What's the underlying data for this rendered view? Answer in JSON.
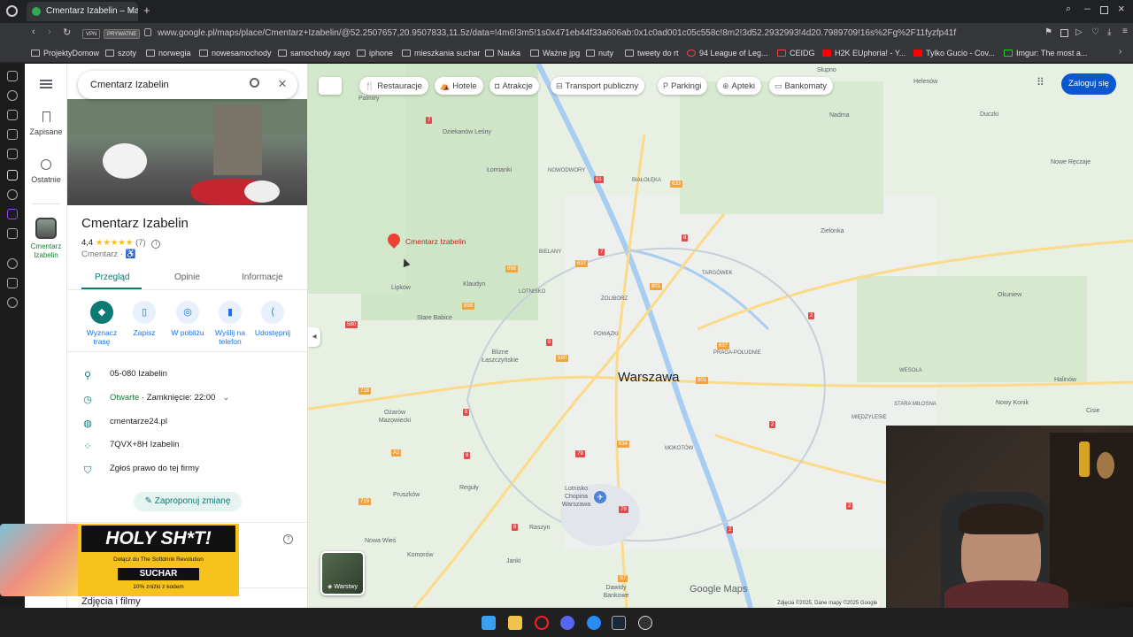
{
  "browser": {
    "tab_title": "Cmentarz Izabelin – Mapy",
    "url": "www.google.pl/maps/place/Cmentarz+Izabelin/@52.2507657,20.9507833,11.5z/data=!4m6!3m5!1s0x471eb44f33a606ab:0x1c0ad001c05c558c!8m2!3d52.2932993!4d20.7989709!16s%2Fg%2F11fyzfp41f",
    "vpn_label": "VPN",
    "private_label": "PRYWATNE",
    "bookmarks": [
      "ProjektyDomow",
      "szoty",
      "norwegia",
      "nowesamochody",
      "samochody xayo",
      "iphone",
      "mieszkania suchar",
      "Nauka",
      "Ważne jpg",
      "nuty",
      "tweety do rt",
      "94 League of Leg...",
      "CEIDG",
      "H2K EUphoria! - Y...",
      "Tylko Gucio - Cov...",
      "Imgur: The most a..."
    ]
  },
  "rail": {
    "saved_label": "Zapisane",
    "recent_label": "Ostatnie",
    "place_label": "Cmentarz Izabelin"
  },
  "panel": {
    "search_value": "Cmentarz Izabelin",
    "place_name": "Cmentarz Izabelin",
    "rating": "4,4",
    "stars": "★★★★★",
    "review_count": "(7)",
    "category": "Cmentarz",
    "tabs": [
      "Przegląd",
      "Opinie",
      "Informacje"
    ],
    "actions": [
      "Wyznacz trasę",
      "Zapisz",
      "W pobliżu",
      "Wyślij na telefon",
      "Udostępnij"
    ],
    "address": "05-080 Izabelin",
    "open_status": "Otwarte",
    "closing": " · Zamknięcie: 22:00",
    "website": "cmentarze24.pl",
    "plus_code": "7QVX+8H Izabelin",
    "claim": "Zgłoś prawo do tej firmy",
    "suggest_edit": "Zaproponuj zmianę",
    "photos_heading": "Zdjęcia i filmy"
  },
  "map": {
    "chips": [
      "Restauracje",
      "Hotele",
      "Atrakcje",
      "Transport publiczny",
      "Parkingi",
      "Apteki",
      "Bankomaty"
    ],
    "login": "Zaloguj się",
    "city": "Warszawa",
    "pin_label": "Cmentarz Izabelin",
    "places": [
      "Palmiry",
      "Dziekanów Leśny",
      "Łomianki",
      "NOWODWORY",
      "BIAŁOŁĘKA",
      "Słupno",
      "Nadma",
      "Helenów",
      "Duczki",
      "Nowe Ręczaje",
      "Zielonka",
      "TARGÓWEK",
      "BIELANY",
      "Lipków",
      "Klaudyn",
      "LOTNISKO",
      "ŻOLIBORZ",
      "Stare Babice",
      "Blizne Łaszczyńskie",
      "POWĄZKI",
      "PRAGA-POŁUDNIE",
      "Okuniew",
      "WESOŁA",
      "Halinów",
      "Ożarów Mazowiecki",
      "STARA MIŁOSNA",
      "MIĘDZYLESIE",
      "Nowy Konik",
      "Cisie",
      "Pruszków",
      "Reguły",
      "MOKOTÓW",
      "Lotnisko Chopina Warszawa",
      "Raszyn",
      "Nowa Wieś",
      "Komorów",
      "Janki",
      "Dawidy Bankowe"
    ],
    "layers": "Warstwy",
    "brand": "Google Maps",
    "attribution": "Zdjęcia ©2025, Dane mapy ©2025 Google"
  },
  "ad": {
    "headline": "HOLY SH*T!",
    "line1": "Dołącz do The Softdrink Revolution",
    "code_word": "SUCHAR",
    "line2": "10% zniżki z kodem"
  },
  "colors": {
    "accent": "#1a73e8",
    "green": "#188038",
    "pin": "#ea4335",
    "teal": "#0b7a75"
  }
}
